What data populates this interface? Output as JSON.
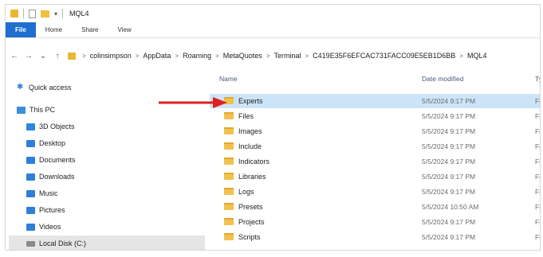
{
  "window": {
    "title": "MQL4"
  },
  "ribbon": {
    "tabs": [
      "File",
      "Home",
      "Share",
      "View"
    ]
  },
  "address": {
    "back": "←",
    "forward": "→",
    "recent": "⌄",
    "up": "↑",
    "crumbs": [
      "colinsimpson",
      "AppData",
      "Roaming",
      "MetaQuotes",
      "Terminal",
      "C419E35F6EFCAC731FACC09E5EB1D6BB",
      "MQL4"
    ],
    "separator": ">"
  },
  "sidebar": {
    "items": [
      {
        "label": "Quick access",
        "icon": "star-icon"
      },
      {
        "label": "This PC",
        "icon": "computer-icon"
      },
      {
        "label": "3D Objects",
        "icon": "3d-objects-icon"
      },
      {
        "label": "Desktop",
        "icon": "desktop-icon"
      },
      {
        "label": "Documents",
        "icon": "documents-icon"
      },
      {
        "label": "Downloads",
        "icon": "downloads-icon"
      },
      {
        "label": "Music",
        "icon": "music-icon"
      },
      {
        "label": "Pictures",
        "icon": "pictures-icon"
      },
      {
        "label": "Videos",
        "icon": "videos-icon"
      },
      {
        "label": "Local Disk (C:)",
        "icon": "disk-icon",
        "selected": true
      }
    ]
  },
  "columns": {
    "name": "Name",
    "date": "Date modified",
    "type": "Ty"
  },
  "files": [
    {
      "name": "Experts",
      "date": "5/5/2024 9:17 PM",
      "type": "Fil",
      "selected": true
    },
    {
      "name": "Files",
      "date": "5/5/2024 9:17 PM",
      "type": "Fil"
    },
    {
      "name": "Images",
      "date": "5/5/2024 9:17 PM",
      "type": "Fil"
    },
    {
      "name": "Include",
      "date": "5/5/2024 9:17 PM",
      "type": "Fil"
    },
    {
      "name": "Indicators",
      "date": "5/5/2024 9:17 PM",
      "type": "Fil"
    },
    {
      "name": "Libraries",
      "date": "5/5/2024 9:17 PM",
      "type": "Fil"
    },
    {
      "name": "Logs",
      "date": "5/5/2024 9:17 PM",
      "type": "Fil"
    },
    {
      "name": "Presets",
      "date": "5/5/2024 10:50 AM",
      "type": "Fil"
    },
    {
      "name": "Projects",
      "date": "5/5/2024 9:17 PM",
      "type": "Fil"
    },
    {
      "name": "Scripts",
      "date": "5/5/2024 9:17 PM",
      "type": "Fil"
    }
  ],
  "colors": {
    "accent": "#1f6fd0",
    "selection": "#cce4f7",
    "folder": "#f2c14e",
    "arrow": "#e02020"
  }
}
